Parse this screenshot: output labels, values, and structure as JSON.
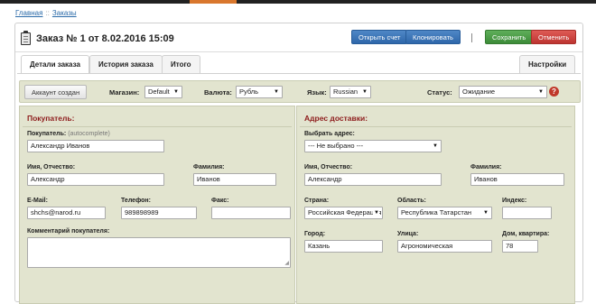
{
  "breadcrumb": {
    "home": "Главная",
    "separator": "::",
    "current": "Заказы"
  },
  "header": {
    "title": "Заказ № 1 от 8.02.2016 15:09",
    "open_invoice": "Открыть счет",
    "clone": "Клонировать",
    "divider": "|",
    "save": "Сохранить",
    "cancel": "Отменить"
  },
  "tabs": {
    "details": "Детали заказа",
    "history": "История заказа",
    "total": "Итого",
    "settings": "Настройки"
  },
  "toolbar": {
    "account_button": "Аккаунт создан",
    "store_label": "Магазин:",
    "store_value": "Default",
    "currency_label": "Валюта:",
    "currency_value": "Рубль",
    "language_label": "Язык:",
    "language_value": "Russian",
    "status_label": "Статус:",
    "status_value": "Ожидание",
    "help": "?"
  },
  "buyer": {
    "title": "Покупатель:",
    "buyer_label": "Покупатель:",
    "buyer_hint": "(autocomplete)",
    "buyer_value": "Александр Иванов",
    "name_label": "Имя, Отчество:",
    "name_value": "Александр",
    "surname_label": "Фамилия:",
    "surname_value": "Иванов",
    "email_label": "E-Mail:",
    "email_value": "shchs@narod.ru",
    "phone_label": "Телефон:",
    "phone_value": "989898989",
    "fax_label": "Факс:",
    "fax_value": "",
    "comment_label": "Комментарий покупателя:",
    "comment_value": ""
  },
  "delivery": {
    "title": "Адрес доставки:",
    "choose_label": "Выбрать адрес:",
    "choose_value": "--- Не выбрано ---",
    "name_label": "Имя, Отчество:",
    "name_value": "Александр",
    "surname_label": "Фамилия:",
    "surname_value": "Иванов",
    "country_label": "Страна:",
    "country_value": "Российская Федерация",
    "region_label": "Область:",
    "region_value": "Республика Татарстан",
    "zip_label": "Индекс:",
    "zip_value": "",
    "city_label": "Город:",
    "city_value": "Казань",
    "street_label": "Улица:",
    "street_value": "Агрономическая",
    "house_label": "Дом, квартира:",
    "house_value": "78"
  },
  "icons": {
    "title": "clipboard-icon",
    "help": "help-icon",
    "dropdown": "chevron-down-icon"
  },
  "colors": {
    "section_bg": "#e2e4cf",
    "section_title": "#8e1c1c",
    "primary": "#2e67aa",
    "success": "#3c8b38",
    "danger": "#bd3531"
  }
}
